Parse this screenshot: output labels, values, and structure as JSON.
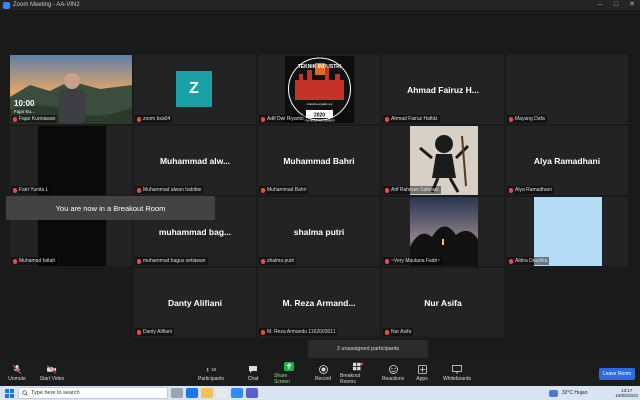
{
  "window": {
    "title": "Zoom Meeting - AA-VIN2"
  },
  "toast": "You are now in a Breakout Room",
  "unassigned": "2 unassigned participants",
  "tiles": [
    {
      "name": "Fajar Kurniawan",
      "overlay_time": "10:00",
      "overlay_sub": "Fajar Ku..."
    },
    {
      "name": "zoom bsa04",
      "avatar": "Z"
    },
    {
      "name": "Adif Dwi Riyanto",
      "logo_top": "TEKNIK INDUSTRI",
      "logo_mid": "industria ergalis ery",
      "logo_year": "2020",
      "logo_bottom": "UNIVERSITAS JEMBER"
    },
    {
      "name": "Ahmad Fairuz Hafidz",
      "big": "Ahmad Fairuz H..."
    },
    {
      "name": "Mayang Dafa"
    },
    {
      "name": "Fatri Yunita L"
    },
    {
      "name": "Muhammad alwan habibie",
      "big": "Muhammad alw..."
    },
    {
      "name": "Muhammad Bahri",
      "big": "Muhammad Bahri"
    },
    {
      "name": "Arif Rahman Sabbani"
    },
    {
      "name": "Alya Ramadhani",
      "big": "Alya Ramadhani"
    },
    {
      "name": "Muhamad fattah"
    },
    {
      "name": "muhammad bagus setiawan",
      "big": "muhammad bag..."
    },
    {
      "name": "shalma putri",
      "big": "shalma putri"
    },
    {
      "name": "~Very Maulana Fadri~"
    },
    {
      "name": "Aldira Desditia"
    },
    {
      "name": "Danty Alifiani",
      "big": "Danty Alifiani"
    },
    {
      "name": "M. Reza Armando 1162003011",
      "big": "M. Reza Armand..."
    },
    {
      "name": "Nur Asifa",
      "big": "Nur Asifa"
    }
  ],
  "controls": {
    "unmute": "Unmute",
    "start_video": "Start Video",
    "participants": "Participants",
    "participants_count": "18",
    "chat": "Chat",
    "share_screen": "Share Screen",
    "record": "Record",
    "breakout_rooms": "Breakout Rooms",
    "reactions": "Reactions",
    "apps": "Apps",
    "whiteboards": "Whiteboards",
    "leave": "Leave Room"
  },
  "taskbar": {
    "search_placeholder": "Type here to search",
    "weather": "32°C Hujan",
    "time": "13:17",
    "date": "19/05/2022"
  },
  "colors": {
    "accent": "#2d8cff",
    "active_speaker": "#b5e53b",
    "muted": "#e5484d",
    "share": "#1fb34a"
  }
}
